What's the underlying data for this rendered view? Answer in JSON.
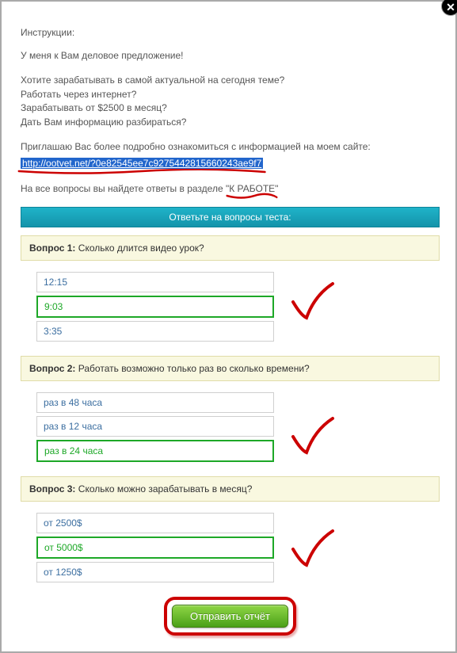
{
  "instructions_label": "Инструкции:",
  "offer_line": "У меня к Вам деловое предложение!",
  "pitch_lines": [
    "Хотите зарабатывать в самой актуальной на сегодня теме?",
    "Работать через интернет?",
    "Зарабатывать от $2500 в месяц?",
    "Дать Вам информацию разбираться?"
  ],
  "invite_line": "Приглашаю Вас более подробно ознакомиться с информацией на моем сайте:",
  "spam_url": "http://ootvet.net/?0e82545ee7c9275442815660243ae9f7",
  "answers_line_prefix": "На все вопросы вы найдете ответы в разделе \"",
  "answers_section_name": "К РАБОТЕ",
  "answers_line_suffix": "\"",
  "test_header": "Ответьте на вопросы теста:",
  "questions": [
    {
      "label_strong": "Вопрос 1:",
      "label_rest": " Сколько длится видео урок?",
      "answers": [
        {
          "text": "12:15",
          "correct": false
        },
        {
          "text": "9:03",
          "correct": true
        },
        {
          "text": "3:35",
          "correct": false
        }
      ]
    },
    {
      "label_strong": "Вопрос 2:",
      "label_rest": " Работать возможно только раз во сколько времени?",
      "answers": [
        {
          "text": "раз в 48 часа",
          "correct": false
        },
        {
          "text": "раз в 12 часа",
          "correct": false
        },
        {
          "text": "раз в 24 часа",
          "correct": true
        }
      ]
    },
    {
      "label_strong": "Вопрос 3:",
      "label_rest": " Сколько можно зарабатывать в месяц?",
      "answers": [
        {
          "text": "от 2500$",
          "correct": false
        },
        {
          "text": "от 5000$",
          "correct": true
        },
        {
          "text": "от 1250$",
          "correct": false
        }
      ]
    }
  ],
  "submit_label": "Отправить отчёт",
  "close_glyph": "✕"
}
